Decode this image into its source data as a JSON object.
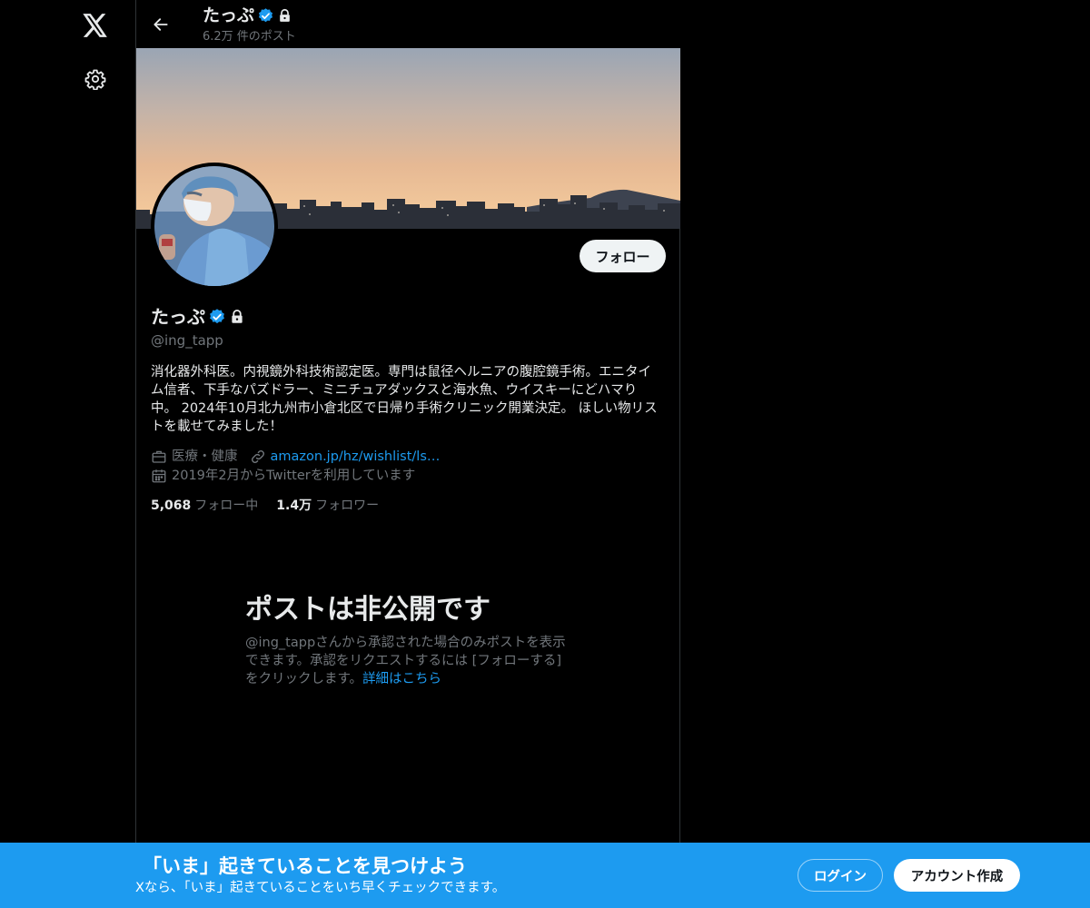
{
  "header": {
    "name": "たっぷ",
    "post_count": "6.2万 件のポスト"
  },
  "profile": {
    "name": "たっぷ",
    "handle": "@ing_tapp",
    "bio": "消化器外科医。内視鏡外科技術認定医。専門は鼠径ヘルニアの腹腔鏡手術。エニタイム信者、下手なパズドラー、ミニチュアダックスと海水魚、ウイスキーにどハマり中。 2024年10月北九州市小倉北区で日帰り手術クリニック開業決定。 ほしい物リストを載せてみました！",
    "category": "医療・健康",
    "link": "amazon.jp/hz/wishlist/ls…",
    "joined": "2019年2月からTwitterを利用しています",
    "follow_button": "フォロー",
    "following_count": "5,068",
    "following_label": "フォロー中",
    "followers_count": "1.4万",
    "followers_label": "フォロワー",
    "verified": true,
    "protected": true
  },
  "private_notice": {
    "title": "ポストは非公開です",
    "description": "@ing_tappさんから承認された場合のみポストを表示できます。承認をリクエストするには [フォローする] をクリックします。",
    "link": "詳細はこちら"
  },
  "bottom_bar": {
    "title": "「いま」起きていることを見つけよう",
    "subtitle": "Xなら、「いま」起きていることをいち早くチェックできます。",
    "login_button": "ログイン",
    "signup_button": "アカウント作成"
  },
  "colors": {
    "accent": "#1d9bf0",
    "background": "#000000",
    "text_primary": "#e7e9ea",
    "text_secondary": "#71767b"
  },
  "icons": [
    "x-logo-icon",
    "settings-icon",
    "back-arrow-icon",
    "verified-badge-icon",
    "lock-icon",
    "briefcase-icon",
    "link-icon",
    "calendar-icon"
  ]
}
